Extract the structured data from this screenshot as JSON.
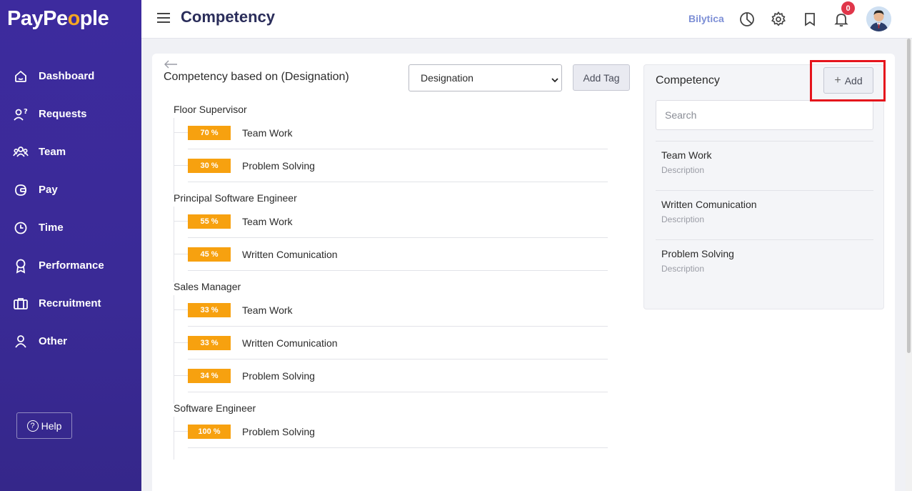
{
  "brand": {
    "logo_pre": "PayPe",
    "logo_o": "o",
    "logo_post": "ple"
  },
  "sidebar": {
    "items": [
      {
        "label": "Dashboard",
        "icon": "home-icon"
      },
      {
        "label": "Requests",
        "icon": "user-question-icon"
      },
      {
        "label": "Team",
        "icon": "team-icon"
      },
      {
        "label": "Pay",
        "icon": "wallet-icon"
      },
      {
        "label": "Time",
        "icon": "clock-icon"
      },
      {
        "label": "Performance",
        "icon": "award-icon"
      },
      {
        "label": "Recruitment",
        "icon": "briefcase-icon"
      },
      {
        "label": "Other",
        "icon": "user-icon"
      }
    ],
    "help_label": "Help"
  },
  "header": {
    "title": "Competency",
    "company": "Bilytica",
    "notification_count": "0"
  },
  "main": {
    "section_title": "Competency based on (Designation)",
    "select_value": "Designation",
    "add_tag_label": "Add Tag",
    "groups": [
      {
        "name": "Floor Supervisor",
        "items": [
          {
            "pct": "70 %",
            "skill": "Team Work"
          },
          {
            "pct": "30 %",
            "skill": "Problem Solving"
          }
        ]
      },
      {
        "name": "Principal Software Engineer",
        "items": [
          {
            "pct": "55 %",
            "skill": "Team Work"
          },
          {
            "pct": "45 %",
            "skill": "Written Comunication"
          }
        ]
      },
      {
        "name": "Sales Manager",
        "items": [
          {
            "pct": "33 %",
            "skill": "Team Work"
          },
          {
            "pct": "33 %",
            "skill": "Written Comunication"
          },
          {
            "pct": "34 %",
            "skill": "Problem Solving"
          }
        ]
      },
      {
        "name": "Software Engineer",
        "items": [
          {
            "pct": "100 %",
            "skill": "Problem Solving"
          }
        ]
      }
    ]
  },
  "competency_panel": {
    "title": "Competency",
    "add_label": "Add",
    "search_placeholder": "Search",
    "items": [
      {
        "name": "Team Work",
        "description": "Description"
      },
      {
        "name": "Written Comunication",
        "description": "Description"
      },
      {
        "name": "Problem Solving",
        "description": "Description"
      }
    ]
  },
  "colors": {
    "sidebar": "#3d2b9e",
    "accent": "#f7a10f",
    "title": "#2a2d5a",
    "badge": "#e0364a",
    "highlight": "#e5141c"
  }
}
